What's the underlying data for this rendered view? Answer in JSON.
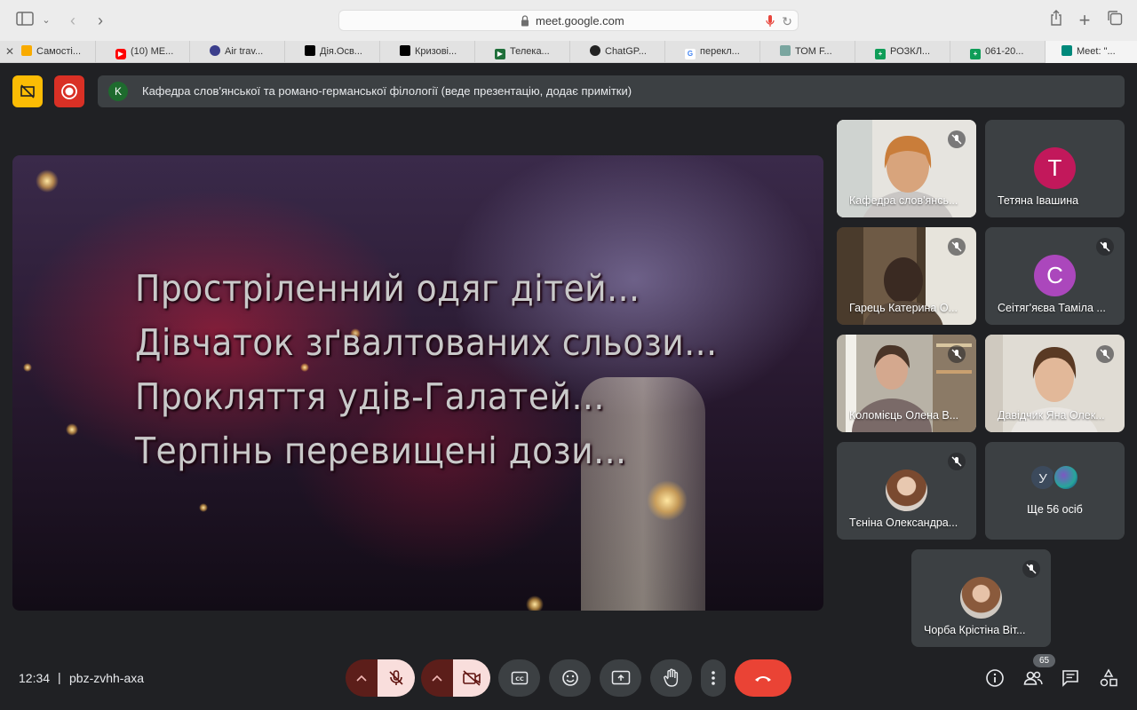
{
  "browser": {
    "url": "meet.google.com",
    "tabs": [
      {
        "label": "Самості...",
        "favicon_color": "#f9ab00"
      },
      {
        "label": "(10) ME...",
        "favicon_color": "#ff0000"
      },
      {
        "label": "Air trav...",
        "favicon_color": "#3b3e8c"
      },
      {
        "label": "Дія.Осв...",
        "favicon_color": "#000000"
      },
      {
        "label": "Кризові...",
        "favicon_color": "#000000"
      },
      {
        "label": "Телека...",
        "favicon_color": "#1f6f3a"
      },
      {
        "label": "ChatGP...",
        "favicon_color": "#222222"
      },
      {
        "label": "перекл...",
        "favicon_color": "#4285f4"
      },
      {
        "label": "ТОМ F...",
        "favicon_color": "#7aa6a0"
      },
      {
        "label": "РОЗКЛ...",
        "favicon_color": "#0f9d58"
      },
      {
        "label": "061-20...",
        "favicon_color": "#0f9d58"
      },
      {
        "label": "Meet: \"...",
        "favicon_color": "#00897b"
      }
    ]
  },
  "meet": {
    "presenter": {
      "initial": "K",
      "text": "Кафедра слов'янської та романо-германської філології (веде презентацію, додає примітки)"
    },
    "slide_lines": [
      "Простріленний одяг дітей...",
      "Дівчаток зґвалтованих сльози...",
      "Прокляття удів-Галатей...",
      "Терпінь перевищені дози..."
    ],
    "participants": [
      {
        "name": "Кафедра слов'янсь...",
        "type": "video",
        "muted": true
      },
      {
        "name": "Тетяна Івашина",
        "type": "initial",
        "initial": "Т",
        "color": "#c2185b",
        "muted": false
      },
      {
        "name": "Гарець Катерина О...",
        "type": "video",
        "muted": true
      },
      {
        "name": "Сеітяг'яєва Таміла ...",
        "type": "initial",
        "initial": "С",
        "color": "#ab47bc",
        "muted": true
      },
      {
        "name": "Коломієць Олена В...",
        "type": "video",
        "muted": true
      },
      {
        "name": "Давідчик Яна Олек...",
        "type": "video",
        "muted": true
      },
      {
        "name": "Тєніна Олександра...",
        "type": "photo",
        "muted": true
      },
      {
        "name": "Ще 56 осіб",
        "type": "more",
        "initial": "У"
      },
      {
        "name": "Чорба Крістіна Віт...",
        "type": "photo",
        "muted": true
      }
    ],
    "time": "12:34",
    "separator": "|",
    "meeting_code": "pbz-zvhh-axa",
    "people_count": "65"
  }
}
